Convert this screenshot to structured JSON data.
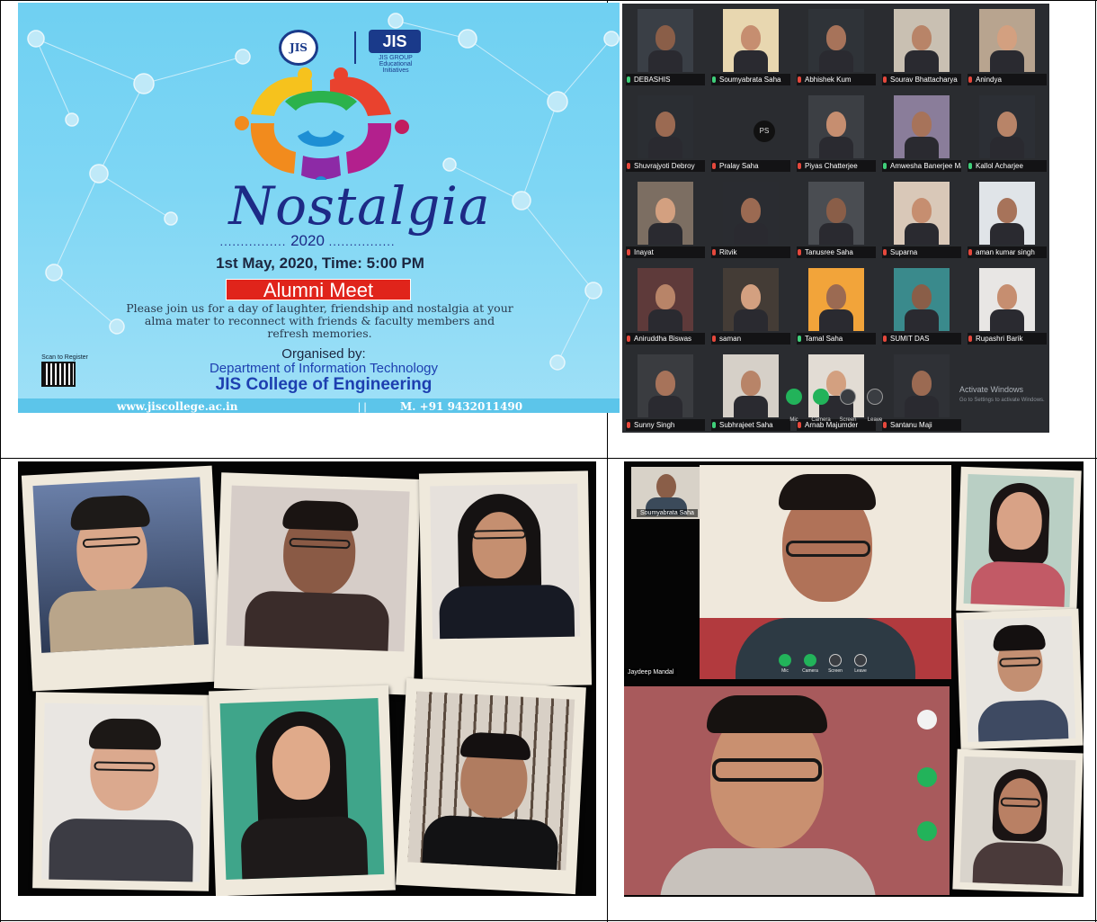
{
  "poster": {
    "seal_text": "JIS",
    "logo_brand": "JIS",
    "logo_sub": "JIS GROUP Educational Initiatives",
    "title": "Nostalgia",
    "year": "2020",
    "date_time": "1st May, 2020, Time: 5:00 PM",
    "banner": "Alumni Meet",
    "invitation": "Please join us for a day of laughter, friendship and nostalgia at your alma mater to reconnect with friends & faculty members and refresh memories.",
    "organised_by": "Organised by:",
    "department": "Department of Information Technology",
    "college": "JIS College of Engineering",
    "qr_label": "Scan to Register",
    "website": "www.jiscollege.ac.in",
    "separator": "| |",
    "phone": "M. +91 9432011490",
    "colors": {
      "background": "#7ed6f4",
      "title": "#1d2a86",
      "banner": "#e0241b",
      "dept": "#1d3fb0"
    }
  },
  "gallery": {
    "participants": [
      {
        "name": "DEBASHIS",
        "mic_on": true
      },
      {
        "name": "Soumyabrata Saha",
        "mic_on": true
      },
      {
        "name": "Abhishek Kum",
        "mic_on": false
      },
      {
        "name": "Sourav Bhattacharya",
        "mic_on": false
      },
      {
        "name": "Anindya",
        "mic_on": false
      },
      {
        "name": "Shuvrajyoti Debroy",
        "mic_on": false
      },
      {
        "name": "Pralay Saha",
        "mic_on": false,
        "avatar": "PS"
      },
      {
        "name": "Piyas Chatterjee",
        "mic_on": false
      },
      {
        "name": "Amwesha Banerjee Maju..",
        "mic_on": true
      },
      {
        "name": "Kallol Acharjee",
        "mic_on": true
      },
      {
        "name": "Inayat",
        "mic_on": false
      },
      {
        "name": "Ritvik",
        "mic_on": false
      },
      {
        "name": "Tanusree Saha",
        "mic_on": false
      },
      {
        "name": "Suparna",
        "mic_on": false
      },
      {
        "name": "aman kumar singh",
        "mic_on": false
      },
      {
        "name": "Aniruddha Biswas",
        "mic_on": false
      },
      {
        "name": "saman",
        "mic_on": false
      },
      {
        "name": "Tamal Saha",
        "mic_on": true
      },
      {
        "name": "SUMIT DAS",
        "mic_on": false
      },
      {
        "name": "Rupashri Barik",
        "mic_on": false
      },
      {
        "name": "Sunny Singh",
        "mic_on": false
      },
      {
        "name": "Subhrajeet Saha",
        "mic_on": true
      },
      {
        "name": "Arnab Majumder",
        "mic_on": false
      },
      {
        "name": "Santanu Maji",
        "mic_on": false
      }
    ],
    "controls": [
      "Mic",
      "Camera",
      "Screen",
      "Leave"
    ],
    "watermark_title": "Activate Windows",
    "watermark_sub": "Go to Settings to activate Windows."
  },
  "conference": {
    "thumb_name": "Soumyabrata Saha",
    "main_name": "Jaydeep Mandal",
    "controls": [
      "Mic",
      "Camera",
      "Screen",
      "Leave"
    ]
  }
}
